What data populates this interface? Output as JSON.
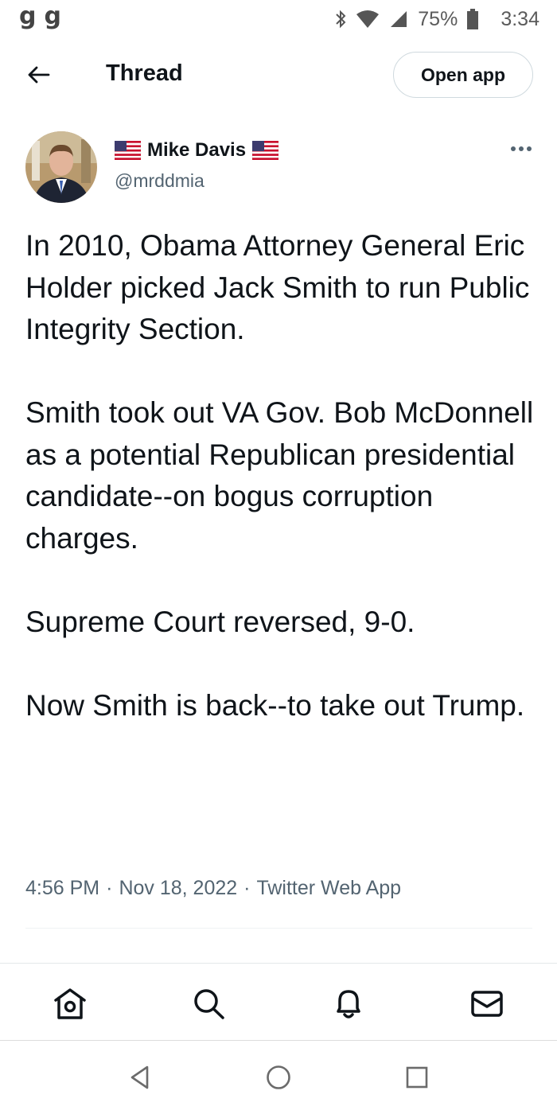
{
  "status_bar": {
    "left_icons": [
      "g",
      "g"
    ],
    "battery": "75%",
    "time": "3:34",
    "icons": [
      "bluetooth-icon",
      "wifi-icon",
      "signal-icon",
      "battery-icon"
    ]
  },
  "header": {
    "title": "Thread",
    "open_app_label": "Open app"
  },
  "author": {
    "name": "Mike Davis",
    "handle": "@mrddmia"
  },
  "tweet": {
    "paragraphs": [
      "In 2010, Obama Attorney General Eric Holder picked Jack Smith to run Public Integrity Section.",
      "Smith took out VA Gov. Bob McDonnell as a potential Republican presidential candidate--on bogus corruption charges.",
      "Supreme Court reversed, 9-0.",
      "Now Smith is back--to take out Trump."
    ],
    "time": "4:56 PM",
    "date": "Nov 18, 2022",
    "source": "Twitter Web App",
    "separator": "·"
  },
  "bottom_nav": [
    "home-icon",
    "search-icon",
    "notifications-icon",
    "messages-icon"
  ],
  "system_nav": [
    "back-icon",
    "home-circle-icon",
    "recents-icon"
  ],
  "colors": {
    "text_primary": "#0f1419",
    "text_secondary": "#536471",
    "border": "#cfd9de"
  }
}
